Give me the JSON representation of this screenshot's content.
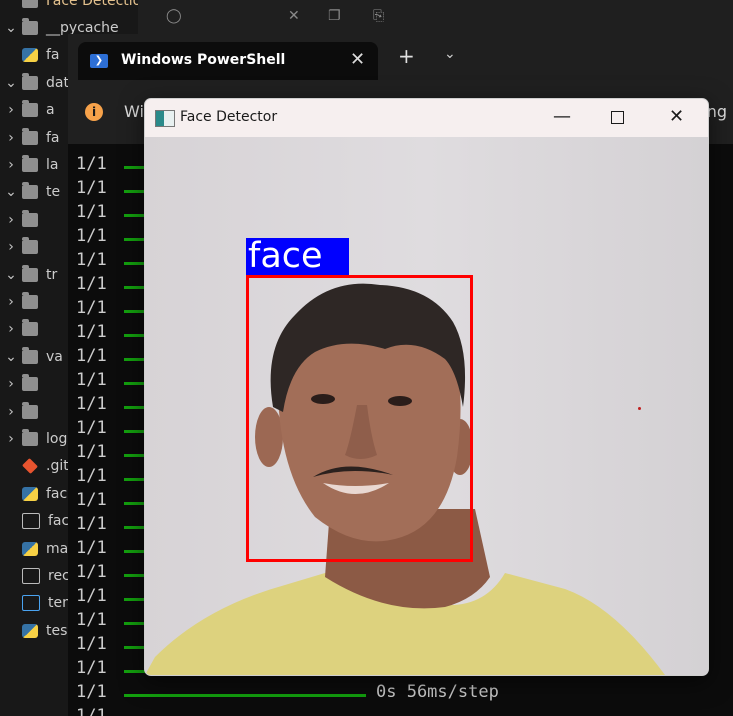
{
  "explorer": {
    "items": [
      {
        "label": "Face Detection",
        "kind": "folder-title",
        "chevron": "",
        "color": "#e2c08d"
      },
      {
        "label": "__pycache__",
        "kind": "folder",
        "chevron": "v"
      },
      {
        "label": "fa",
        "kind": "py"
      },
      {
        "label": "data",
        "kind": "folder",
        "chevron": "v"
      },
      {
        "label": "a",
        "kind": "folder",
        "chevron": ">"
      },
      {
        "label": "fa",
        "kind": "folder",
        "chevron": ">"
      },
      {
        "label": "la",
        "kind": "folder",
        "chevron": ">"
      },
      {
        "label": "te",
        "kind": "folder",
        "chevron": "v"
      },
      {
        "label": "",
        "kind": "folder",
        "chevron": ">"
      },
      {
        "label": "",
        "kind": "folder",
        "chevron": ">"
      },
      {
        "label": "tr",
        "kind": "folder",
        "chevron": "v"
      },
      {
        "label": "",
        "kind": "folder",
        "chevron": ">"
      },
      {
        "label": "",
        "kind": "folder",
        "chevron": ">"
      },
      {
        "label": "va",
        "kind": "folder",
        "chevron": "v"
      },
      {
        "label": "",
        "kind": "folder",
        "chevron": ">"
      },
      {
        "label": "",
        "kind": "folder",
        "chevron": ">"
      },
      {
        "label": "log",
        "kind": "folder",
        "chevron": ">"
      },
      {
        "label": ".git",
        "kind": "git"
      },
      {
        "label": "fac",
        "kind": "py"
      },
      {
        "label": "fac",
        "kind": "doc"
      },
      {
        "label": "ma",
        "kind": "py"
      },
      {
        "label": "rec",
        "kind": "doc"
      },
      {
        "label": "ten",
        "kind": "blue-doc"
      },
      {
        "label": "tes",
        "kind": "py"
      }
    ]
  },
  "powershell": {
    "tab_title": "Windows PowerShell",
    "tab_close": "✕",
    "new_tab": "+",
    "dropdown": "⌄",
    "info_icon": "i",
    "info_text_left": "Wi",
    "info_text_right": "ting",
    "terminal_lines": [
      {
        "step": "1/1",
        "timing": ""
      },
      {
        "step": "1/1",
        "timing": ""
      },
      {
        "step": "1/1",
        "timing": ""
      },
      {
        "step": "1/1",
        "timing": ""
      },
      {
        "step": "1/1",
        "timing": ""
      },
      {
        "step": "1/1",
        "timing": ""
      },
      {
        "step": "1/1",
        "timing": ""
      },
      {
        "step": "1/1",
        "timing": ""
      },
      {
        "step": "1/1",
        "timing": ""
      },
      {
        "step": "1/1",
        "timing": ""
      },
      {
        "step": "1/1",
        "timing": ""
      },
      {
        "step": "1/1",
        "timing": ""
      },
      {
        "step": "1/1",
        "timing": ""
      },
      {
        "step": "1/1",
        "timing": ""
      },
      {
        "step": "1/1",
        "timing": ""
      },
      {
        "step": "1/1",
        "timing": ""
      },
      {
        "step": "1/1",
        "timing": ""
      },
      {
        "step": "1/1",
        "timing": ""
      },
      {
        "step": "1/1",
        "timing": ""
      },
      {
        "step": "1/1",
        "timing": ""
      },
      {
        "step": "1/1",
        "timing": ""
      },
      {
        "step": "1/1",
        "timing": ""
      },
      {
        "step": "1/1",
        "timing": "0s 56ms/step"
      },
      {
        "step": "1/1",
        "timing": ""
      }
    ],
    "bar_color": "#13a10e"
  },
  "face_detector": {
    "title": "Face Detector",
    "minimize": "—",
    "maximize": "",
    "close": "✕",
    "detection_label": "face",
    "label_bg": "#0000ff",
    "box_color": "#ff0000"
  }
}
